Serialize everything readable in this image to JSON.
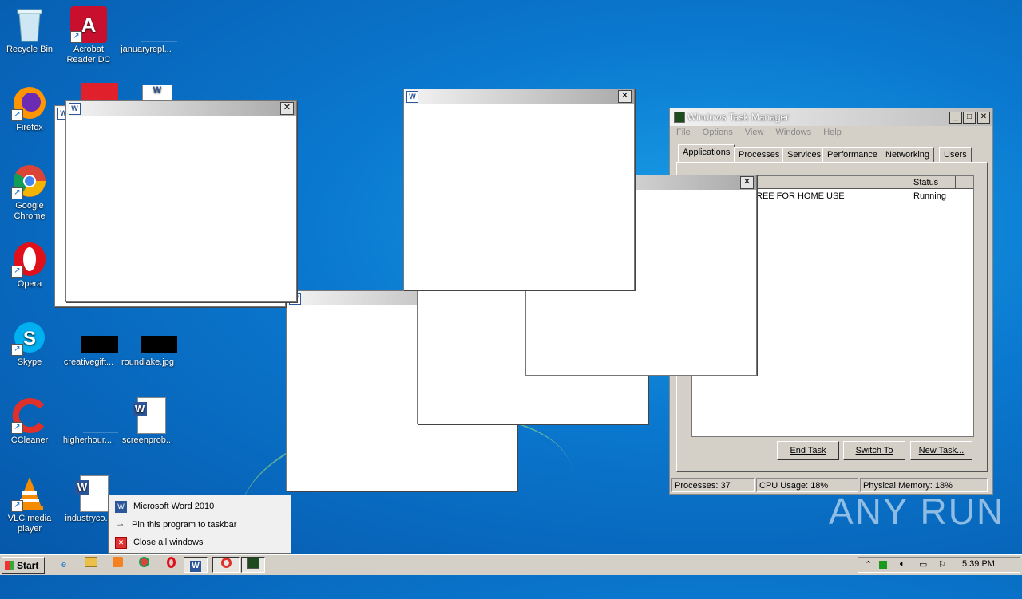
{
  "desktop": {
    "icons": [
      {
        "label": "Recycle Bin",
        "icon": "recycle-bin-icon"
      },
      {
        "label": "Acrobat Reader DC",
        "icon": "acrobat-icon"
      },
      {
        "label": "januaryrepl...",
        "icon": "file-icon"
      },
      {
        "label": "Firefox",
        "icon": "firefox-icon"
      },
      {
        "label": "Google Chrome",
        "icon": "chrome-icon"
      },
      {
        "label": "Opera",
        "icon": "opera-icon"
      },
      {
        "label": "Skype",
        "icon": "skype-icon"
      },
      {
        "label": "creativegift...",
        "icon": "image-file-icon"
      },
      {
        "label": "roundlake.jpg",
        "icon": "image-file-icon"
      },
      {
        "label": "CCleaner",
        "icon": "ccleaner-icon"
      },
      {
        "label": "higherhour....",
        "icon": "file-icon"
      },
      {
        "label": "screenprob...",
        "icon": "word-doc-icon"
      },
      {
        "label": "VLC media player",
        "icon": "vlc-icon"
      },
      {
        "label": "industryco...",
        "icon": "word-doc-icon"
      }
    ],
    "watermark": "ANY RUN"
  },
  "task_manager": {
    "title": "Windows Task Manager",
    "menu": [
      "File",
      "Options",
      "View",
      "Windows",
      "Help"
    ],
    "tabs": [
      "Applications",
      "Processes",
      "Services",
      "Performance",
      "Networking",
      "Users"
    ],
    "active_tab": "Applications",
    "columns": {
      "status": "Status"
    },
    "rows": [
      {
        "task": "REE FOR HOME USE",
        "status": "Running"
      }
    ],
    "buttons": {
      "end_task": "End Task",
      "switch_to": "Switch To",
      "new_task": "New Task..."
    },
    "statusbar": {
      "processes": "Processes: 37",
      "cpu": "CPU Usage: 18%",
      "memory": "Physical Memory: 18%"
    }
  },
  "jump_list": {
    "items": [
      "Microsoft Word 2010",
      "Pin this program to taskbar",
      "Close all windows"
    ]
  },
  "taskbar": {
    "start_label": "Start",
    "clock": "5:39 PM"
  },
  "colors": {
    "desktop": "#0a78cf",
    "chrome_gray": "#d4d0c8",
    "word_blue": "#2b579a"
  }
}
